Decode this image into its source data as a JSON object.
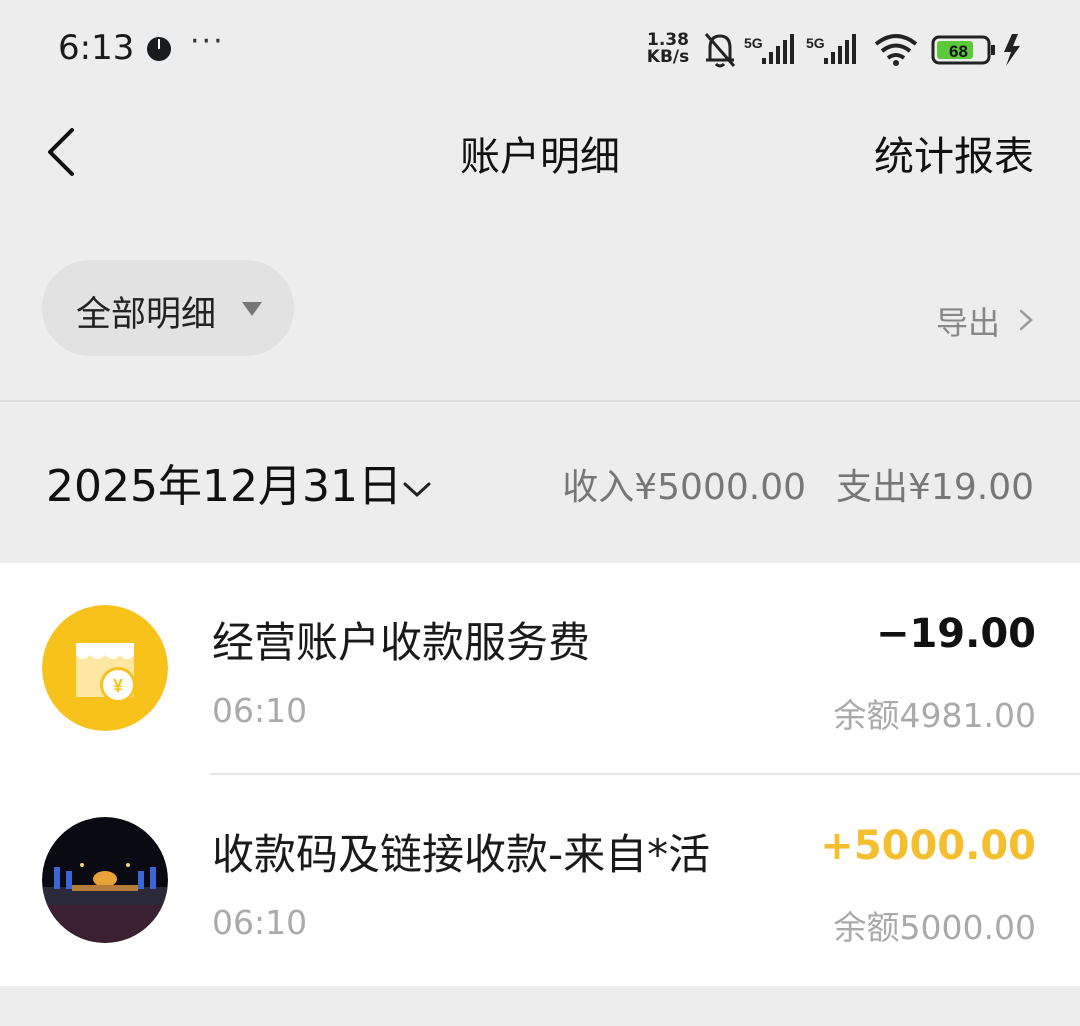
{
  "status_bar": {
    "time": "6:13",
    "dots": "···",
    "net_speed_value": "1.38",
    "net_speed_unit": "KB/s",
    "battery": "68",
    "sim1": "5G",
    "sim2": "5G"
  },
  "nav": {
    "title": "账户明细",
    "report_label": "统计报表"
  },
  "filter": {
    "selected": "全部明细"
  },
  "export": {
    "label": "导出"
  },
  "date_group": {
    "date": "2025年12月31日",
    "income": "收入¥5000.00",
    "expense": "支出¥19.00"
  },
  "transactions": [
    {
      "title": "经营账户收款服务费",
      "time": "06:10",
      "amount": "−19.00",
      "balance": "余额4981.00",
      "icon": "shop-yuan-icon"
    },
    {
      "title": "收款码及链接收款-来自*活",
      "time": "06:10",
      "amount": "+5000.00",
      "balance": "余额5000.00",
      "icon": "user-avatar-photo"
    }
  ],
  "colors": {
    "income_amount": "#f5be2e",
    "expense_amount": "#111111",
    "merchant_icon_bg": "#f8c21d",
    "page_bg": "#ededed"
  }
}
